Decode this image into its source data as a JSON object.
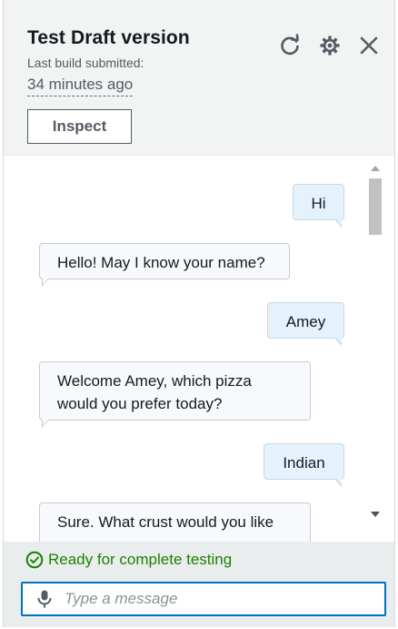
{
  "header": {
    "title": "Test Draft version",
    "subtitle": "Last build submitted:",
    "time": "34 minutes ago",
    "inspect_label": "Inspect",
    "icons": [
      "refresh-icon",
      "settings-icon",
      "close-icon"
    ]
  },
  "messages": [
    {
      "role": "user",
      "text": "Hi"
    },
    {
      "role": "bot",
      "text": "Hello! May I know your name?"
    },
    {
      "role": "user",
      "text": "Amey"
    },
    {
      "role": "bot",
      "text": "Welcome Amey, which pizza would you prefer today?"
    },
    {
      "role": "user",
      "text": "Indian"
    },
    {
      "role": "bot",
      "text": "Sure. What crust would you like"
    }
  ],
  "footer": {
    "status": "Ready for complete testing",
    "input_placeholder": "Type a message"
  },
  "colors": {
    "accent": "#0073bb",
    "success": "#1d8102",
    "user_bubble": "#e6f2fb",
    "bot_bubble": "#f7f9fc"
  }
}
